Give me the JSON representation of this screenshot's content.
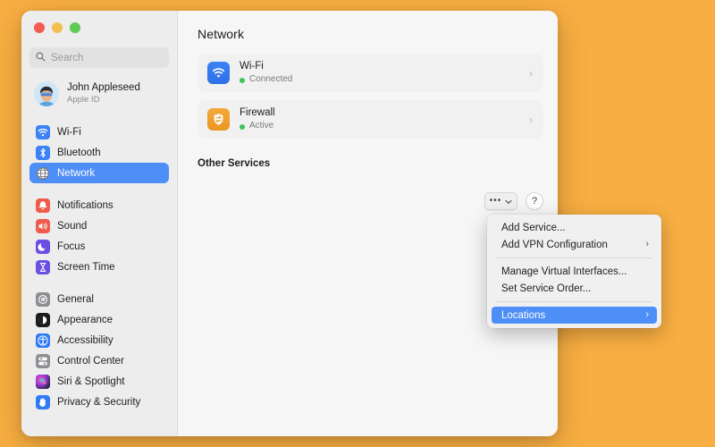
{
  "desktop": {
    "background_color": "#F8AE42"
  },
  "window": {
    "sidebar": {
      "search": {
        "placeholder": "Search",
        "value": "",
        "icon": "search-icon"
      },
      "profile": {
        "name": "John Appleseed",
        "subtitle": "Apple ID",
        "avatar": "memoji-avatar"
      },
      "groups": [
        {
          "items": [
            {
              "label": "Wi-Fi",
              "icon": "wifi-icon",
              "selected": false
            },
            {
              "label": "Bluetooth",
              "icon": "bluetooth-icon",
              "selected": false
            },
            {
              "label": "Network",
              "icon": "globe-icon",
              "selected": true
            }
          ]
        },
        {
          "items": [
            {
              "label": "Notifications",
              "icon": "bell-icon",
              "selected": false
            },
            {
              "label": "Sound",
              "icon": "speaker-icon",
              "selected": false
            },
            {
              "label": "Focus",
              "icon": "moon-icon",
              "selected": false
            },
            {
              "label": "Screen Time",
              "icon": "hourglass-icon",
              "selected": false
            }
          ]
        },
        {
          "items": [
            {
              "label": "General",
              "icon": "gear-icon",
              "selected": false
            },
            {
              "label": "Appearance",
              "icon": "appearance-icon",
              "selected": false
            },
            {
              "label": "Accessibility",
              "icon": "accessibility-icon",
              "selected": false
            },
            {
              "label": "Control Center",
              "icon": "control-center-icon",
              "selected": false
            },
            {
              "label": "Siri & Spotlight",
              "icon": "siri-icon",
              "selected": false
            },
            {
              "label": "Privacy & Security",
              "icon": "hand-icon",
              "selected": false
            }
          ]
        }
      ]
    },
    "main": {
      "title": "Network",
      "services": [
        {
          "name": "Wi-Fi",
          "status": "Connected",
          "status_color": "#3FC45B",
          "icon": "wifi-icon",
          "chevron": "›"
        },
        {
          "name": "Firewall",
          "status": "Active",
          "status_color": "#3FC45B",
          "icon": "firewall-icon",
          "chevron": "›"
        }
      ],
      "other_services_title": "Other Services",
      "toolbar": {
        "more_label": "•••",
        "more_chevron": "⌄",
        "help_label": "?"
      }
    },
    "context_menu": {
      "items": [
        {
          "label": "Add Service...",
          "submenu": false,
          "highlighted": false
        },
        {
          "label": "Add VPN Configuration",
          "submenu": true,
          "highlighted": false,
          "chevron": "›"
        },
        {
          "separator": true
        },
        {
          "label": "Manage Virtual Interfaces...",
          "submenu": false,
          "highlighted": false
        },
        {
          "label": "Set Service Order...",
          "submenu": false,
          "highlighted": false
        },
        {
          "separator": true
        },
        {
          "label": "Locations",
          "submenu": true,
          "highlighted": true,
          "chevron": "›"
        }
      ]
    }
  },
  "colors": {
    "accent": "#4E8EF7",
    "window_bg": "#F6F6F6",
    "sidebar_bg": "#EDEDED",
    "menu_bg": "#F0F0F0",
    "status_green": "#3FC45B"
  }
}
